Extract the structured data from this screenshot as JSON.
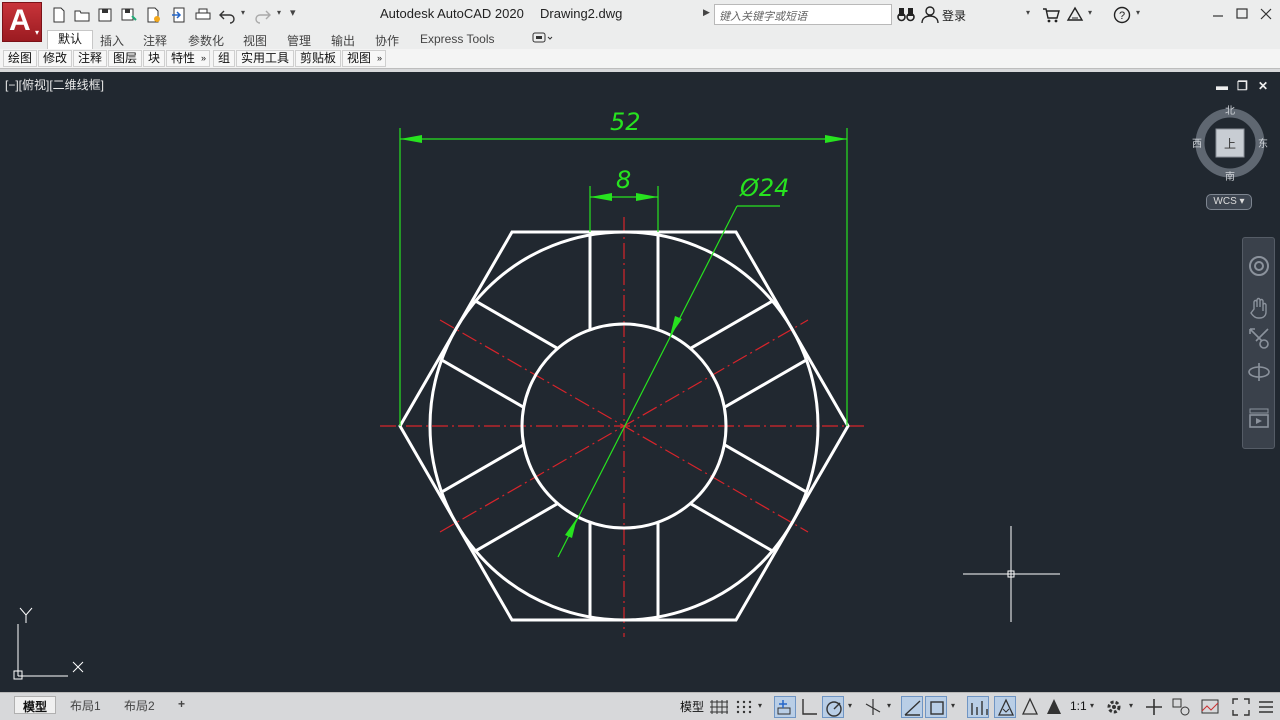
{
  "titlebar": {
    "app_name": "Autodesk AutoCAD 2020",
    "file_name": "Drawing2.dwg",
    "search_placeholder": "键入关键字或短语",
    "login_label": "登录"
  },
  "ribbon_tabs": [
    "默认",
    "插入",
    "注释",
    "参数化",
    "视图",
    "管理",
    "输出",
    "协作",
    "Express Tools"
  ],
  "ribbon_panels": [
    "绘图",
    "修改",
    "注释",
    "图层",
    "块",
    "特性",
    "组",
    "实用工具",
    "剪贴板",
    "视图"
  ],
  "viewport": {
    "label": "[−][俯视][二维线框]",
    "viewcube": {
      "north": "北",
      "south": "南",
      "east": "东",
      "west": "西",
      "face": "上",
      "wcs": "WCS"
    },
    "ucs": {
      "x_label": "X",
      "y_label": "Y"
    }
  },
  "drawing": {
    "dim_overall": "52",
    "dim_slot": "8",
    "dim_diameter": "Ø24",
    "colors": {
      "background": "#212830",
      "geometry": "#ffffff",
      "dimension": "#27e31f",
      "centerline": "#d8242b"
    }
  },
  "layout_tabs": [
    "模型",
    "布局1",
    "布局2",
    "+"
  ],
  "statusbar": {
    "model_label": "模型",
    "scale_label": "1:1"
  }
}
